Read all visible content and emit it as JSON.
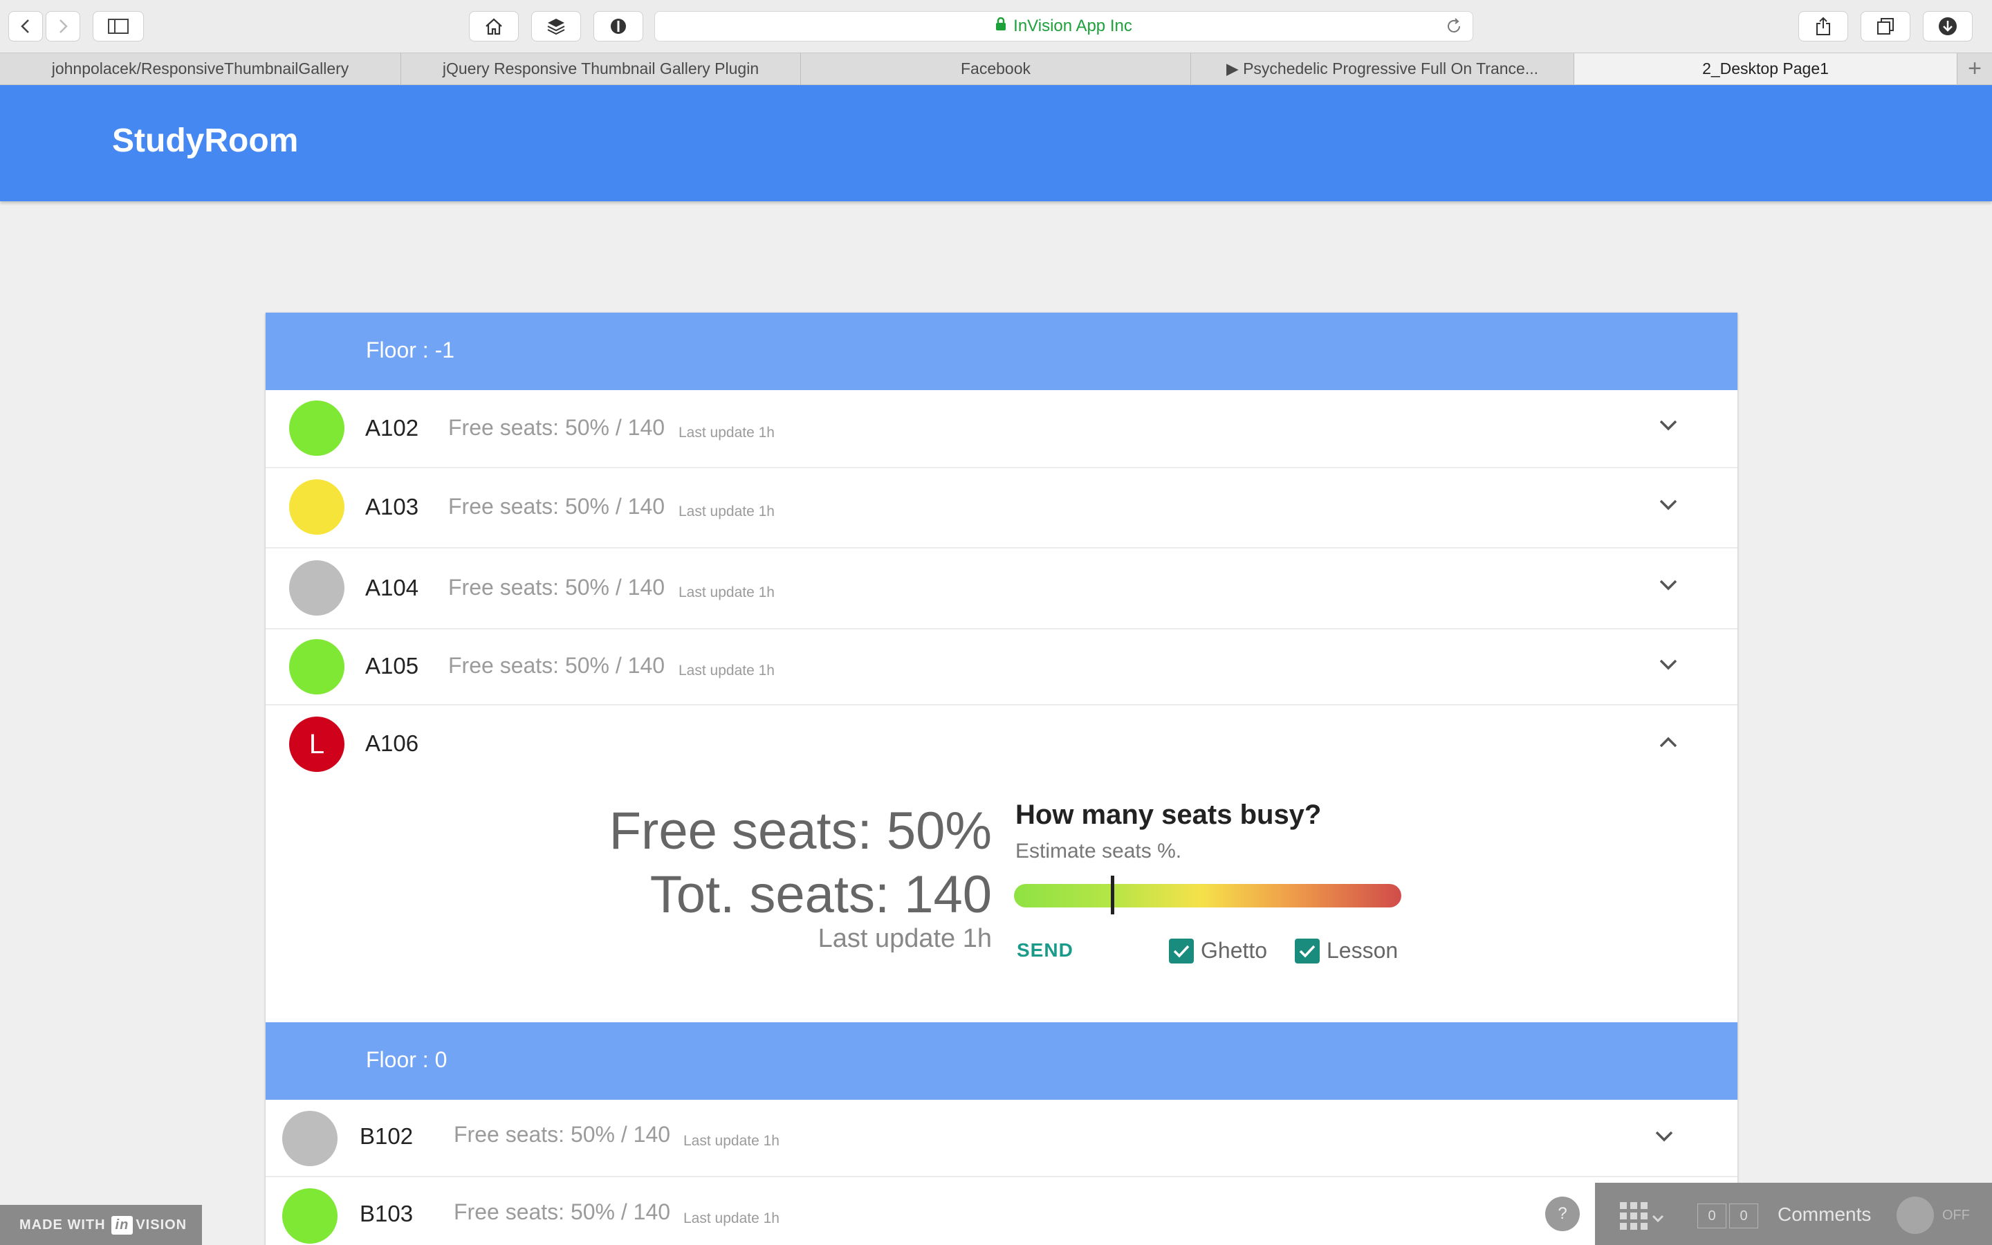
{
  "browser": {
    "url_text": "InVision App Inc",
    "tabs": [
      "johnpolacek/ResponsiveThumbnailGallery",
      "jQuery Responsive Thumbnail Gallery Plugin",
      "Facebook",
      "▶ Psychedelic Progressive Full On Trance...",
      "2_Desktop Page1"
    ]
  },
  "app": {
    "title": "StudyRoom"
  },
  "floors": [
    {
      "label": "Floor :  -1",
      "rooms": [
        {
          "name": "A102",
          "free_text": "Free seats: 50% / 140",
          "update_text": "Last update 1h",
          "status_color": "#7ee834"
        },
        {
          "name": "A103",
          "free_text": "Free seats: 50% / 140",
          "update_text": "Last update 1h",
          "status_color": "#f6e43a"
        },
        {
          "name": "A104",
          "free_text": "Free seats: 50% / 140",
          "update_text": "Last update 1h",
          "status_color": "#bdbdbd"
        },
        {
          "name": "A105",
          "free_text": "Free seats: 50% / 140",
          "update_text": "Last update 1h",
          "status_color": "#7ee834"
        },
        {
          "name": "A106",
          "badge": "L",
          "status_color": "#d0021b"
        }
      ]
    },
    {
      "label": "Floor :  0",
      "rooms": [
        {
          "name": "B102",
          "free_text": "Free seats: 50% / 140",
          "update_text": "Last update 1h",
          "status_color": "#bdbdbd"
        },
        {
          "name": "B103",
          "free_text": "Free seats: 50% / 140",
          "update_text": "Last update 1h",
          "status_color": "#7ee834"
        }
      ]
    }
  ],
  "expanded": {
    "free_seats": "Free seats: 50%",
    "tot_seats": "Tot. seats:  140",
    "last_update": "Last update 1h",
    "question": "How many seats busy?",
    "subtitle": "Estimate seats %.",
    "slider_fraction": 0.25,
    "send_label": "SEND",
    "checkboxes": [
      {
        "label": "Ghetto",
        "checked": true
      },
      {
        "label": "Lesson",
        "checked": true
      }
    ]
  },
  "footer": {
    "made_with": "MADE WITH",
    "invision_in": "in",
    "invision_rest": "VISION",
    "help": "?",
    "count_a": "0",
    "count_b": "0",
    "comments_label": "Comments",
    "toggle_label": "OFF"
  }
}
